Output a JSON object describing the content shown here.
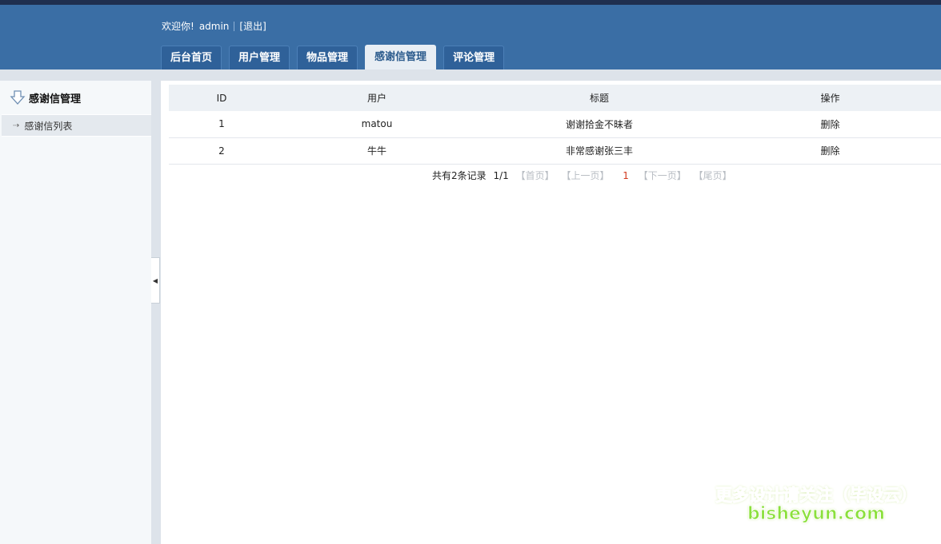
{
  "header": {
    "welcome": "欢迎你!",
    "username": "admin",
    "logout": "[退出]",
    "tabs": [
      {
        "label": "后台首页"
      },
      {
        "label": "用户管理"
      },
      {
        "label": "物品管理"
      },
      {
        "label": "感谢信管理",
        "active": true
      },
      {
        "label": "评论管理"
      }
    ]
  },
  "sidebar": {
    "title": "感谢信管理",
    "items": [
      {
        "label": "感谢信列表"
      }
    ]
  },
  "table": {
    "columns": [
      "ID",
      "用户",
      "标题",
      "操作"
    ],
    "rows": [
      {
        "id": "1",
        "user": "matou",
        "title": "谢谢拾金不昧者",
        "action": "删除"
      },
      {
        "id": "2",
        "user": "牛牛",
        "title": "非常感谢张三丰",
        "action": "删除"
      }
    ]
  },
  "pager": {
    "summary": "共有2条记录",
    "page_of": "1/1",
    "first": "【首页】",
    "prev": "【上一页】",
    "current": "1",
    "next": "【下一页】",
    "last": "【尾页】"
  },
  "watermark": {
    "line1": "更多设计请关注（毕设云）",
    "line2": "bisheyun.com"
  },
  "colors": {
    "header_bg": "#3a6ea5",
    "accent": "#2a5a8c",
    "current_page": "#d23a1e",
    "watermark": "#8be03c"
  }
}
